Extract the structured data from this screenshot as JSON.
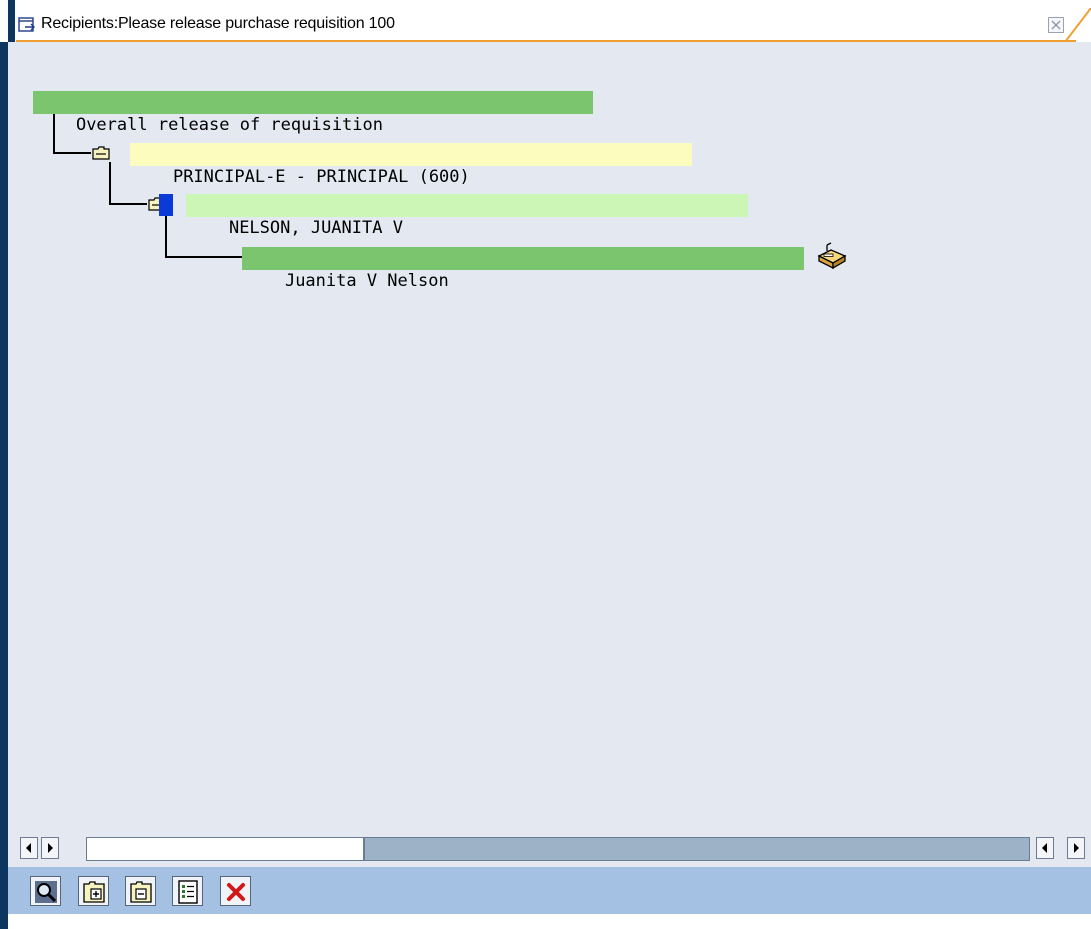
{
  "window": {
    "title": "Recipients:Please release purchase requisition 100"
  },
  "tree": {
    "root": {
      "label": "Overall release of requisition"
    },
    "level1": {
      "label": "PRINCIPAL-E - PRINCIPAL (600)"
    },
    "level2": {
      "label": "NELSON, JUANITA V"
    },
    "level3": {
      "label": "Juanita V Nelson"
    }
  },
  "colors": {
    "tree_background": "#e4e9f1",
    "node_green": "#7cc56f",
    "node_yellow": "#fdfcbf",
    "node_light_green": "#ccf6b6",
    "toolbar_background": "#a4c0e2",
    "title_accent": "#f0a030",
    "frame_dark_blue": "#0c3560"
  },
  "icons": {
    "title": "dialog-icon",
    "close": "close-icon",
    "folder": "folder-icon",
    "mailbox": "inbox-icon",
    "toolbar": [
      "find-icon",
      "expand-icon",
      "collapse-icon",
      "details-icon",
      "cancel-icon"
    ]
  }
}
